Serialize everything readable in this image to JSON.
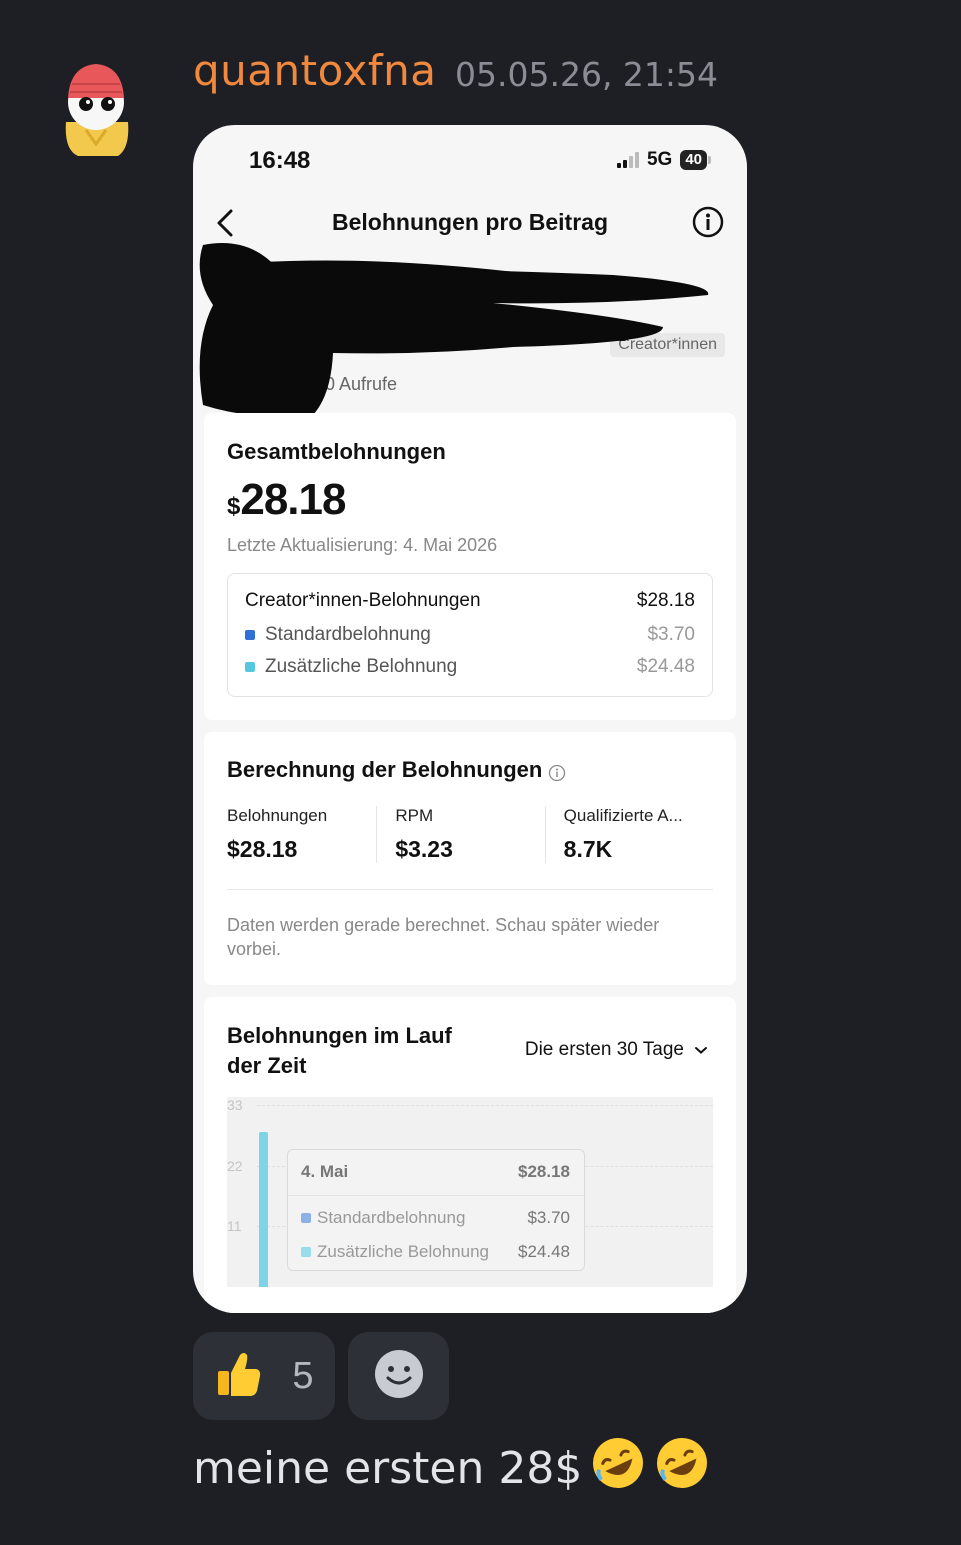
{
  "message": {
    "username": "quantoxfna",
    "timestamp": "05.05.26, 21:54",
    "text": "meine ersten 28$",
    "emojis": [
      "rofl-emoji",
      "rofl-emoji"
    ],
    "username_color": "#f0883e"
  },
  "reactions": [
    {
      "icon": "thumbs-up-emoji",
      "count": "5"
    },
    {
      "icon": "add-reaction-icon"
    }
  ],
  "screenshot": {
    "status": {
      "time": "16:48",
      "network": "5G",
      "battery": "40"
    },
    "nav": {
      "title": "Belohnungen pro Beitrag"
    },
    "post_meta": {
      "tag": "Creator*innen",
      "views": "0 Aufrufe"
    },
    "total": {
      "title": "Gesamtbelohnungen",
      "currency": "$",
      "amount": "28.18",
      "updated": "Letzte Aktualisierung: 4. Mai 2026",
      "breakdown": {
        "header_label": "Creator*innen-Belohnungen",
        "header_value": "$28.18",
        "items": [
          {
            "label": "Standardbelohnung",
            "value": "$3.70",
            "color": "#2f6fd6"
          },
          {
            "label": "Zusätzliche Belohnung",
            "value": "$24.48",
            "color": "#55c8e0"
          }
        ]
      }
    },
    "calculation": {
      "title": "Berechnung der Belohnungen",
      "metrics": [
        {
          "label": "Belohnungen",
          "value": "$28.18"
        },
        {
          "label": "RPM",
          "value": "$3.23"
        },
        {
          "label": "Qualifizierte A...",
          "value": "8.7K"
        }
      ],
      "note": "Daten werden gerade berechnet. Schau später wieder vorbei."
    },
    "over_time": {
      "title": "Belohnungen im Lauf der Zeit",
      "range": "Die ersten 30 Tage",
      "yticks": [
        "33",
        "22",
        "11"
      ],
      "tooltip": {
        "date": "4. Mai",
        "total": "$28.18",
        "items": [
          {
            "label": "Standardbelohnung",
            "value": "$3.70",
            "color": "#8db0e6"
          },
          {
            "label": "Zusätzliche Belohnung",
            "value": "$24.48",
            "color": "#9adbe9"
          }
        ]
      }
    }
  },
  "chart_data": {
    "type": "bar",
    "categories": [
      "4. Mai"
    ],
    "series": [
      {
        "name": "Standardbelohnung",
        "values": [
          3.7
        ]
      },
      {
        "name": "Zusätzliche Belohnung",
        "values": [
          24.48
        ]
      }
    ],
    "ylim": [
      0,
      33
    ],
    "yticks": [
      33,
      22,
      11
    ]
  }
}
